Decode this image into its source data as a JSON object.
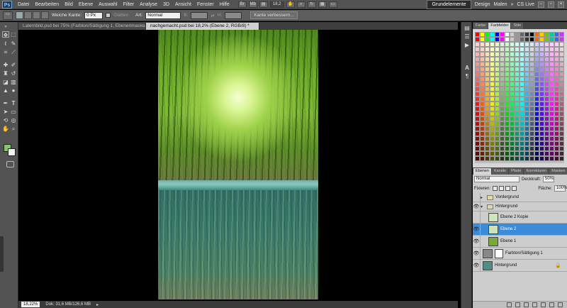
{
  "menu": {
    "logo": "Ps",
    "items": [
      "Datei",
      "Bearbeiten",
      "Bild",
      "Ebene",
      "Auswahl",
      "Filter",
      "Analyse",
      "3D",
      "Ansicht",
      "Fenster",
      "Hilfe"
    ],
    "zoom_value": "18,2",
    "workspaces": [
      "Grundelemente",
      "Design",
      "Malen"
    ],
    "active_workspace": "Grundelemente",
    "cslive": "CS Live"
  },
  "options": {
    "soft_edge_label": "Weiche Kante:",
    "soft_edge_value": "0 Px",
    "smooth_label": "Glätten",
    "style_label": "Art:",
    "style_value": "Normal",
    "width_label": "B:",
    "height_label": "H:",
    "refine_edge_button": "Kante verbessern..."
  },
  "tabs": [
    {
      "label": "Laternbild.psd bei 75% (Farbton/Sättigung 1, Ebenenmaske/8) *",
      "active": false
    },
    {
      "label": "nachgemacht.psd bei 18,2% (Ebene 2, RGB/8) *",
      "active": true
    }
  ],
  "status": {
    "zoom": "18,22%",
    "doc": "Dok: 31,6 MB/126,6 MB"
  },
  "panels": {
    "swatch_tabs": [
      "Farbe",
      "Farbfelder",
      "Stile"
    ],
    "active_swatch_tab": "Farbfelder",
    "layer_tabs": [
      "Ebenen",
      "Kanäle",
      "Pfade",
      "Korrekturen",
      "Masken"
    ],
    "active_layer_tab": "Ebenen",
    "blend_mode": "Normal",
    "opacity_label": "Deckkraft:",
    "opacity_value": "50%",
    "fill_label": "Fläche:",
    "fill_value": "100%",
    "lock_label": "Fixieren:"
  },
  "layers": [
    {
      "name": "Vordergrund",
      "type": "group",
      "visible": false,
      "expanded": false,
      "indent": false
    },
    {
      "name": "Hintergrund",
      "type": "group",
      "visible": true,
      "expanded": true,
      "indent": false
    },
    {
      "name": "Ebene 2 Kopie",
      "type": "layer",
      "visible": false,
      "indent": true,
      "thumb": "#cde3b8"
    },
    {
      "name": "Ebene 2",
      "type": "layer",
      "visible": true,
      "indent": true,
      "selected": true,
      "thumb": "#cde3b8"
    },
    {
      "name": "Ebene 1",
      "type": "layer",
      "visible": true,
      "indent": true,
      "thumb": "#78a838"
    },
    {
      "name": "Farbton/Sättigung 1",
      "type": "adjustment",
      "visible": true,
      "indent": false,
      "thumb": "#888888"
    },
    {
      "name": "Hintergrund",
      "type": "layer",
      "visible": true,
      "indent": false,
      "locked": true,
      "thumb": "#4c8f86"
    }
  ],
  "colors": {
    "foreground": "#8bc176",
    "background": "#f4f4f4",
    "selection": "#3a8cd9"
  }
}
